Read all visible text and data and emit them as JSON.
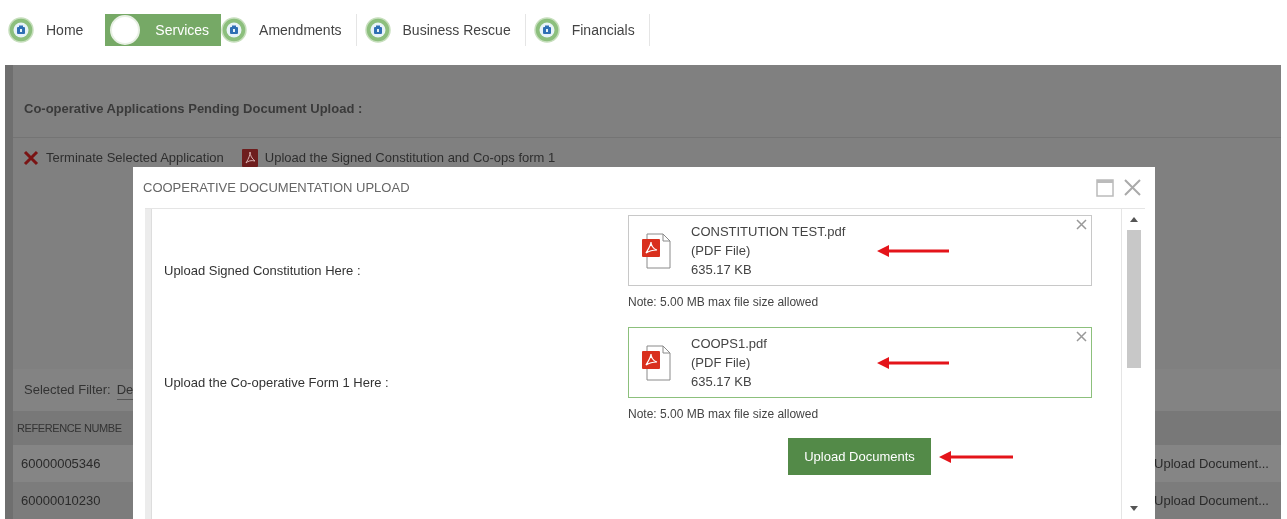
{
  "nav": [
    {
      "label": "Home",
      "selected": false
    },
    {
      "label": "Services",
      "selected": true
    },
    {
      "label": "Amendments",
      "selected": false
    },
    {
      "label": "Business Rescue",
      "selected": false
    },
    {
      "label": "Financials",
      "selected": false
    }
  ],
  "panel": {
    "title": "Co-operative Applications Pending Document Upload :",
    "actions": [
      {
        "kind": "terminate",
        "label": "Terminate Selected Application"
      },
      {
        "kind": "pdf",
        "label": "Upload the Signed Constitution and Co-ops form 1"
      }
    ],
    "filter_label": "Selected Filter:",
    "filter_value": "De",
    "column_1": "REFERENCE NUMBE",
    "rows": [
      {
        "reference": "60000005346",
        "action": "Upload Document..."
      },
      {
        "reference": "60000010230",
        "action": "Upload Document..."
      }
    ]
  },
  "dialog": {
    "title": "COOPERATIVE DOCUMENTATION UPLOAD",
    "uploads": [
      {
        "label": "Upload Signed Constitution Here :",
        "file_name": "CONSTITUTION TEST.pdf",
        "file_type": "(PDF File)",
        "file_size": "635.17 KB",
        "selected": false,
        "note": "Note: 5.00 MB max file size allowed",
        "annotated": true
      },
      {
        "label": "Upload the Co-operative Form 1 Here :",
        "file_name": "COOPS1.pdf",
        "file_type": "(PDF File)",
        "file_size": "635.17 KB",
        "selected": true,
        "note": "Note: 5.00 MB max file size allowed",
        "annotated": true
      }
    ],
    "submit": {
      "label": "Upload Documents",
      "annotated": true
    }
  }
}
